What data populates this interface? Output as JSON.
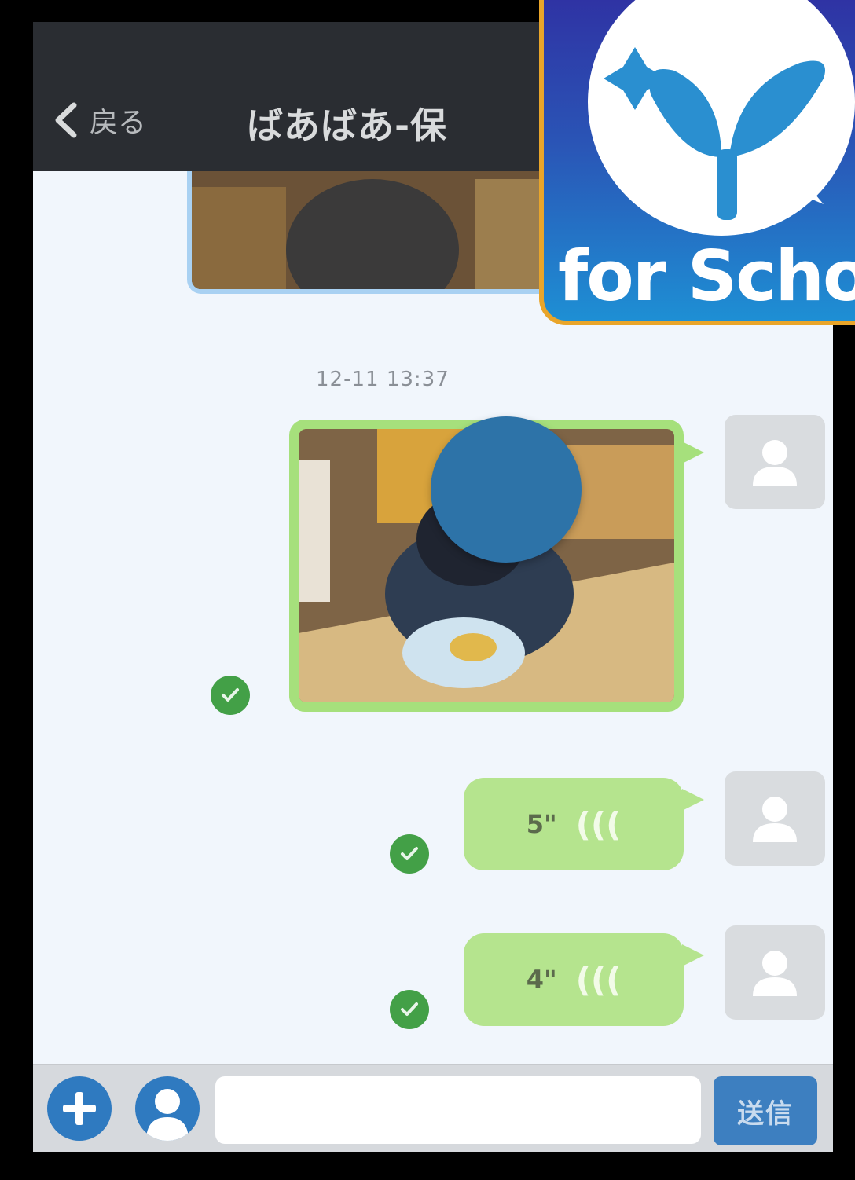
{
  "header": {
    "back_label": "戻る",
    "title": "ばあばあ-保"
  },
  "messages": {
    "timestamp": "12-11 13:37",
    "voice_1_duration": "5\"",
    "voice_2_duration": "4\""
  },
  "input": {
    "placeholder": "",
    "send_label": "送信"
  },
  "badge": {
    "label": "for Schoo"
  },
  "colors": {
    "header_bg": "#2a2d32",
    "chat_bg": "#f1f6fc",
    "sent_bubble": "#b5e48e",
    "accent_blue": "#2f7ac0",
    "read_check": "#43a047"
  }
}
